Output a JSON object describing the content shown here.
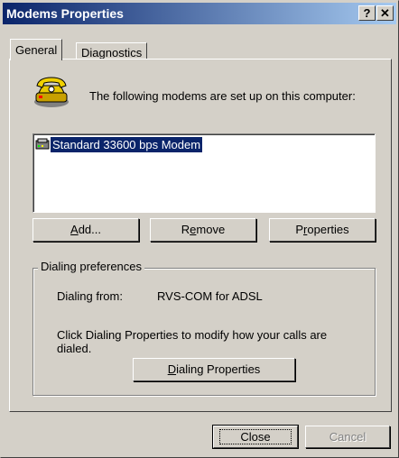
{
  "window": {
    "title": "Modems Properties",
    "help_button": "?",
    "close_button": "✕"
  },
  "tabs": [
    {
      "label": "General"
    },
    {
      "label": "Diagnostics"
    }
  ],
  "general": {
    "intro_text": "The following modems are set up on this computer:",
    "modems": [
      "Standard 33600 bps Modem"
    ],
    "buttons": {
      "add": {
        "pre": "",
        "key": "A",
        "post": "dd..."
      },
      "remove": {
        "pre": "R",
        "key": "e",
        "post": "move"
      },
      "properties": {
        "pre": "P",
        "key": "r",
        "post": "operties"
      }
    },
    "dialing": {
      "group_label": "Dialing preferences",
      "from_label": "Dialing from:",
      "from_value": "RVS-COM for ADSL",
      "hint_line1": "Click Dialing Properties to modify how your calls are",
      "hint_line2": "dialed.",
      "button": {
        "pre": "",
        "key": "D",
        "post": "ialing Properties"
      }
    }
  },
  "footer": {
    "close_label": "Close",
    "cancel_label": "Cancel"
  },
  "icons": {
    "modem_dialog_icon": "telephone-modem-icon",
    "list_item_icon": "modem-icon"
  }
}
